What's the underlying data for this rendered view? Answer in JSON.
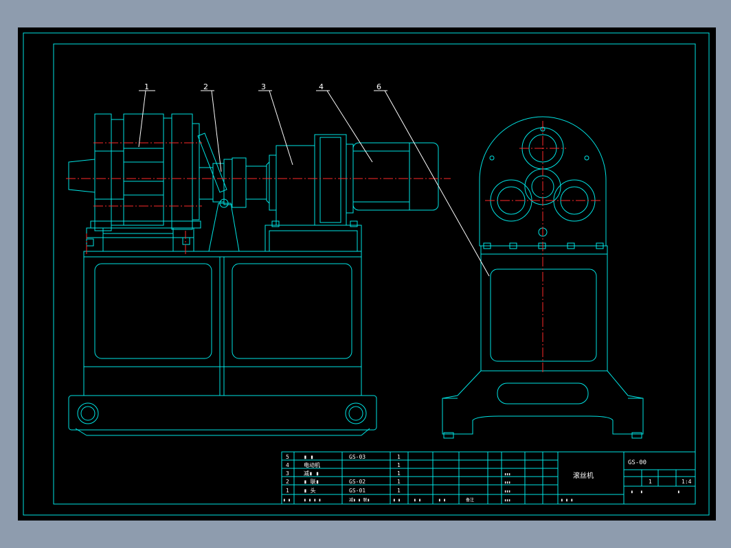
{
  "drawing": {
    "balloons": [
      "1",
      "2",
      "3",
      "4",
      "6"
    ]
  },
  "parts_list": {
    "rows": [
      {
        "no": "5",
        "name": "▮ ▮",
        "code": "GS-03",
        "qty": "1"
      },
      {
        "no": "4",
        "name": "电动机",
        "code": "",
        "qty": "1"
      },
      {
        "no": "3",
        "name": "减▮ ▮",
        "code": "",
        "qty": "1"
      },
      {
        "no": "2",
        "name": "▮ 联▮",
        "code": "GS-02",
        "qty": "1"
      },
      {
        "no": "1",
        "name": "▮ 头",
        "code": "GS-01",
        "qty": "1"
      }
    ],
    "header": {
      "no": "▮ ▮",
      "name": "▮ ▮ ▮ ▮",
      "code": "减▮ ▮ 联▮",
      "qty": "▮ ▮",
      "c5": "▮ ▮",
      "c6": "▮ ▮",
      "c7": "备注"
    }
  },
  "title_block": {
    "drawing_code": "GS-00",
    "product_name": "滚丝机",
    "quantity": "1",
    "scale": "1:4",
    "sheet_label_a": "▮",
    "sheet_label_b": "▮",
    "sheet_label_c": "▮",
    "company": "▮ ▮ ▮",
    "sign_rows": [
      "▮▮▮",
      "▮▮▮",
      "▮▮▮",
      "▮▮▮"
    ]
  },
  "colors": {
    "background": "#000000",
    "outline": "#00e5e5",
    "centerline": "#ff2a2a",
    "text": "#ffffff",
    "window_frame": "#8e9cae"
  }
}
